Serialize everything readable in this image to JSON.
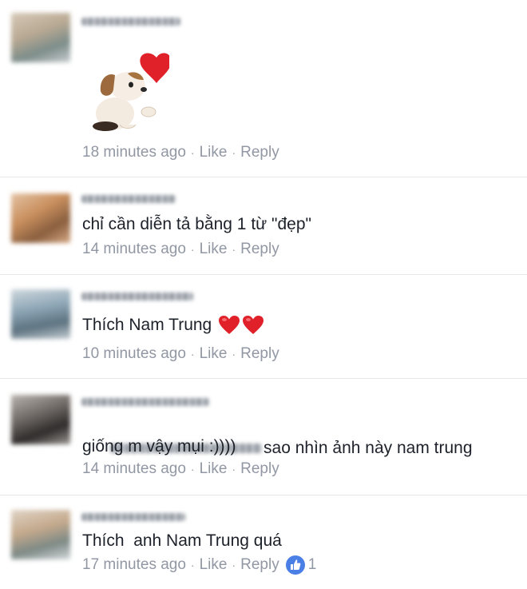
{
  "comments": [
    {
      "sticker": "dog-blowing-heart-sticker",
      "time": "18 minutes ago",
      "like": "Like",
      "reply": "Reply"
    },
    {
      "text": "chỉ cần diễn tả bằng 1 từ \"đẹp\"",
      "time": "14 minutes ago",
      "like": "Like",
      "reply": "Reply"
    },
    {
      "text": "Thích Nam Trung",
      "emoji": "red-heart-icon",
      "time": "10 minutes ago",
      "like": "Like",
      "reply": "Reply"
    },
    {
      "line1": "sao nhìn ảnh này nam trung",
      "line2": "giống m vậy mụi :))))",
      "time": "14 minutes ago",
      "like": "Like",
      "reply": "Reply"
    },
    {
      "text": "Thích  anh Nam Trung quá",
      "time": "17 minutes ago",
      "like": "Like",
      "reply": "Reply",
      "reaction_icon": "thumbs-up-icon",
      "like_count": "1"
    }
  ],
  "separator": "·",
  "colors": {
    "text": "#1d2129",
    "meta": "#9197a3",
    "divider": "#e6e7ea",
    "like_blue": "#4a7fe6",
    "heart_red": "#e0212a"
  }
}
